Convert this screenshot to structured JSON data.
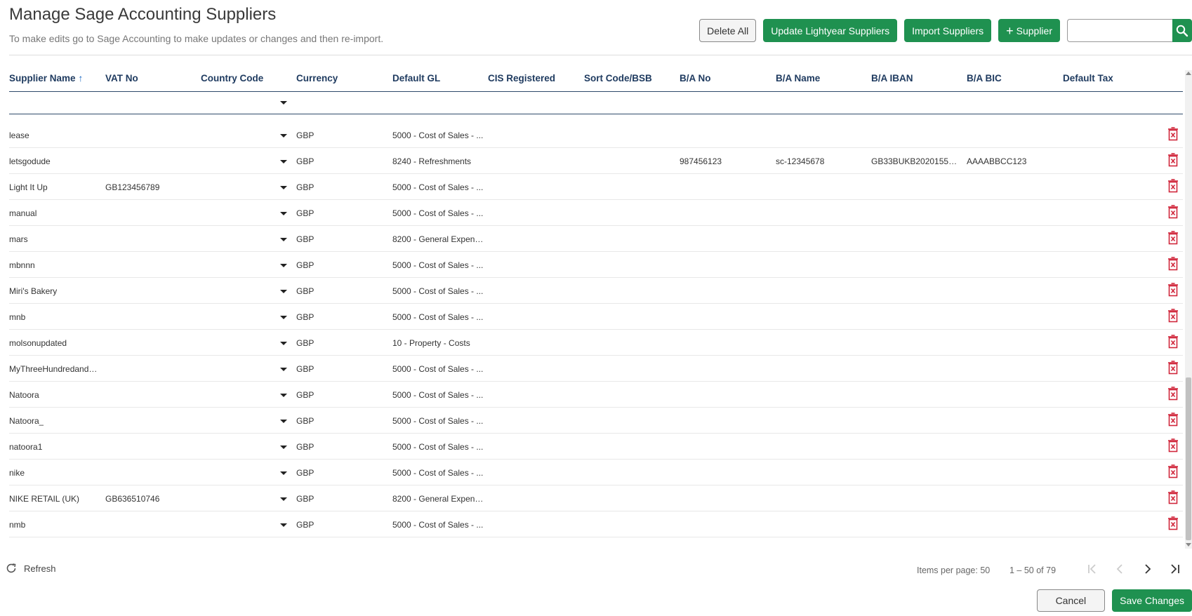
{
  "header": {
    "title": "Manage Sage Accounting Suppliers",
    "subtitle": "To make edits go to Sage Accounting to make updates or changes and then re-import."
  },
  "toolbar": {
    "delete_all": "Delete All",
    "update_lightyear": "Update Lightyear Suppliers",
    "import_suppliers": "Import Suppliers",
    "add_supplier": "Supplier",
    "search_value": ""
  },
  "columns": [
    "Supplier Name",
    "VAT No",
    "Country Code",
    "Currency",
    "Default GL",
    "CIS Registered",
    "Sort Code/BSB",
    "B/A No",
    "B/A Name",
    "B/A IBAN",
    "B/A BIC",
    "Default Tax"
  ],
  "sort": {
    "column": "Supplier Name",
    "direction": "ascending"
  },
  "rows": [
    {
      "name": "lease",
      "vat": "",
      "currency": "GBP",
      "gl": "5000 - Cost of Sales - ...",
      "ba_no": "",
      "ba_name": "",
      "iban": "",
      "bic": ""
    },
    {
      "name": "letsgodude",
      "vat": "",
      "currency": "GBP",
      "gl": "8240 - Refreshments",
      "ba_no": "987456123",
      "ba_name": "sc-12345678",
      "iban": "GB33BUKB202015555...",
      "bic": "AAAABBCC123"
    },
    {
      "name": "Light It Up",
      "vat": "GB123456789",
      "currency": "GBP",
      "gl": "5000 - Cost of Sales - ...",
      "ba_no": "",
      "ba_name": "",
      "iban": "",
      "bic": ""
    },
    {
      "name": "manual",
      "vat": "",
      "currency": "GBP",
      "gl": "5000 - Cost of Sales - ...",
      "ba_no": "",
      "ba_name": "",
      "iban": "",
      "bic": ""
    },
    {
      "name": "mars",
      "vat": "",
      "currency": "GBP",
      "gl": "8200 - General Expenses",
      "ba_no": "",
      "ba_name": "",
      "iban": "",
      "bic": ""
    },
    {
      "name": "mbnnn",
      "vat": "",
      "currency": "GBP",
      "gl": "5000 - Cost of Sales - ...",
      "ba_no": "",
      "ba_name": "",
      "iban": "",
      "bic": ""
    },
    {
      "name": "Miri's Bakery",
      "vat": "",
      "currency": "GBP",
      "gl": "5000 - Cost of Sales - ...",
      "ba_no": "",
      "ba_name": "",
      "iban": "",
      "bic": ""
    },
    {
      "name": "mnb",
      "vat": "",
      "currency": "GBP",
      "gl": "5000 - Cost of Sales - ...",
      "ba_no": "",
      "ba_name": "",
      "iban": "",
      "bic": ""
    },
    {
      "name": "molsonupdated",
      "vat": "",
      "currency": "GBP",
      "gl": "10 - Property - Costs",
      "ba_no": "",
      "ba_name": "",
      "iban": "",
      "bic": ""
    },
    {
      "name": "MyThreeHundredand4...",
      "vat": "",
      "currency": "GBP",
      "gl": "5000 - Cost of Sales - ...",
      "ba_no": "",
      "ba_name": "",
      "iban": "",
      "bic": ""
    },
    {
      "name": "Natoora",
      "vat": "",
      "currency": "GBP",
      "gl": "5000 - Cost of Sales - ...",
      "ba_no": "",
      "ba_name": "",
      "iban": "",
      "bic": ""
    },
    {
      "name": "Natoora_",
      "vat": "",
      "currency": "GBP",
      "gl": "5000 - Cost of Sales - ...",
      "ba_no": "",
      "ba_name": "",
      "iban": "",
      "bic": ""
    },
    {
      "name": "natoora1",
      "vat": "",
      "currency": "GBP",
      "gl": "5000 - Cost of Sales - ...",
      "ba_no": "",
      "ba_name": "",
      "iban": "",
      "bic": ""
    },
    {
      "name": "nike",
      "vat": "",
      "currency": "GBP",
      "gl": "5000 - Cost of Sales - ...",
      "ba_no": "",
      "ba_name": "",
      "iban": "",
      "bic": ""
    },
    {
      "name": "NIKE RETAIL (UK)",
      "vat": "GB636510746",
      "currency": "GBP",
      "gl": "8200 - General Expenses",
      "ba_no": "",
      "ba_name": "",
      "iban": "",
      "bic": ""
    },
    {
      "name": "nmb",
      "vat": "",
      "currency": "GBP",
      "gl": "5000 - Cost of Sales - ...",
      "ba_no": "",
      "ba_name": "",
      "iban": "",
      "bic": ""
    }
  ],
  "footer": {
    "refresh": "Refresh",
    "items_per_page": "Items per page: 50",
    "range": "1 – 50 of 79",
    "cancel": "Cancel",
    "save": "Save Changes"
  },
  "colors": {
    "accent": "#1f9150",
    "delete": "#d0263b",
    "header_text": "#1e3a5f",
    "sort": "#1565c0"
  },
  "icons": {
    "search": "search-icon",
    "delete": "delete-icon",
    "refresh": "refresh-icon",
    "dropdown": "chevron-down-icon"
  }
}
